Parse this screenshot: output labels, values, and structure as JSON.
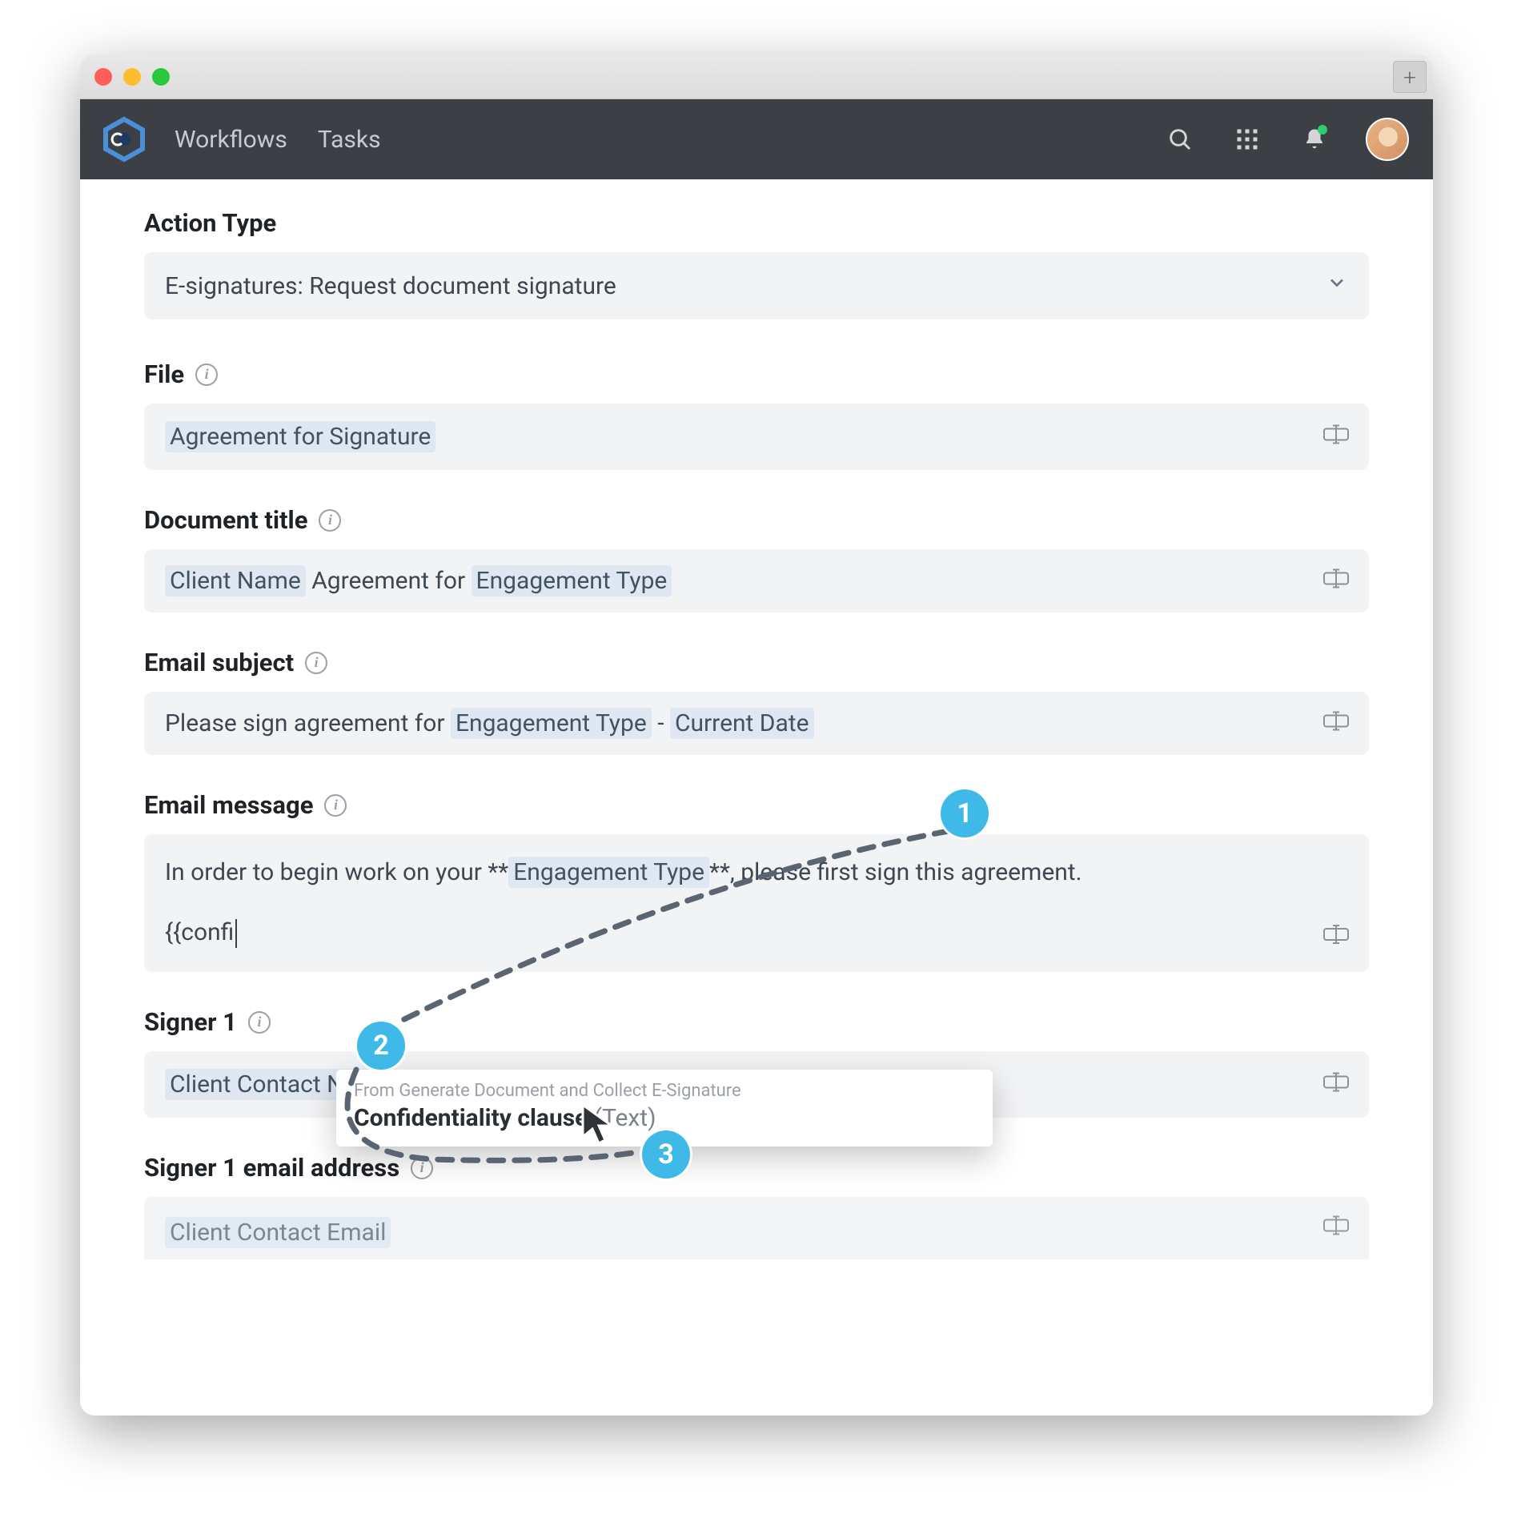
{
  "titlebar": {
    "plus": "+"
  },
  "nav": {
    "workflows": "Workflows",
    "tasks": "Tasks"
  },
  "form": {
    "actionType": {
      "label": "Action Type",
      "value": "E-signatures: Request document signature"
    },
    "file": {
      "label": "File",
      "chip1": "Agreement for Signature"
    },
    "docTitle": {
      "label": "Document title",
      "chip1": "Client Name",
      "mid": " Agreement for ",
      "chip2": "Engagement Type"
    },
    "emailSubject": {
      "label": "Email subject",
      "pre": "Please sign agreement for ",
      "chip1": "Engagement Type",
      "mid": " - ",
      "chip2": "Current Date"
    },
    "emailMessage": {
      "label": "Email message",
      "line1_pre": "In order to begin work on your **",
      "line1_chip": "Engagement Type",
      "line1_post": "**, please first sign this agreement.",
      "line2": "{{confi"
    },
    "signer1": {
      "label": "Signer 1",
      "chip1": "Client Contact Name"
    },
    "signer1Email": {
      "label": "Signer 1 email address",
      "chip1": "Client Contact Email"
    }
  },
  "autocomplete": {
    "from": "From Generate Document and Collect E-Signature",
    "name": "Confidentiality clause",
    "type": " (Text)"
  },
  "callouts": {
    "c1": "1",
    "c2": "2",
    "c3": "3"
  }
}
